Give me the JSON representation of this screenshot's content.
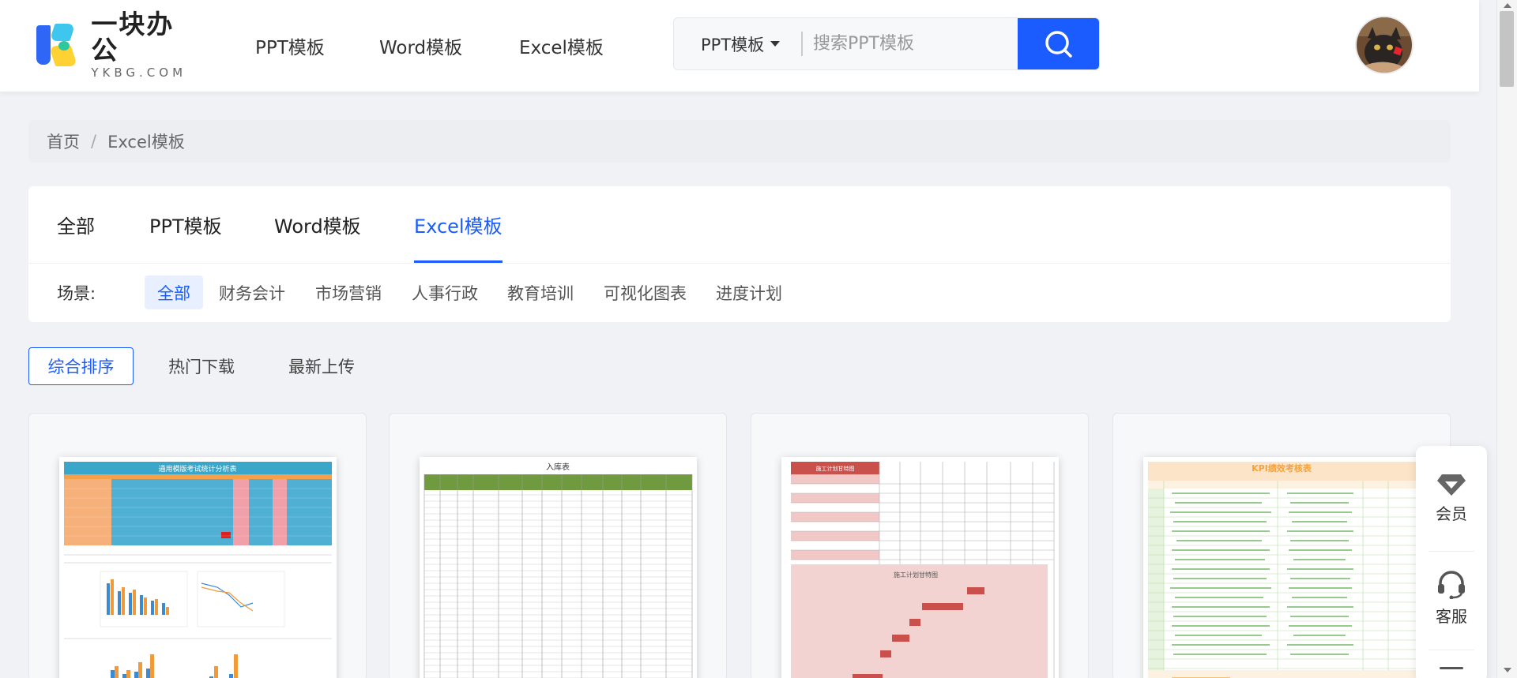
{
  "header": {
    "logo": {
      "name": "一块办公",
      "domain": "YKBG.COM"
    },
    "nav": [
      {
        "label": "PPT模板"
      },
      {
        "label": "Word模板"
      },
      {
        "label": "Excel模板"
      }
    ],
    "search": {
      "type_label": "PPT模板",
      "placeholder": "搜索PPT模板",
      "value": ""
    }
  },
  "breadcrumb": {
    "home": "首页",
    "separator": "/",
    "current": "Excel模板"
  },
  "category_tabs": [
    {
      "label": "全部",
      "active": false
    },
    {
      "label": "PPT模板",
      "active": false
    },
    {
      "label": "Word模板",
      "active": false
    },
    {
      "label": "Excel模板",
      "active": true
    }
  ],
  "scenes": {
    "label": "场景:",
    "items": [
      {
        "label": "全部",
        "active": true
      },
      {
        "label": "财务会计"
      },
      {
        "label": "市场营销"
      },
      {
        "label": "人事行政"
      },
      {
        "label": "教育培训"
      },
      {
        "label": "可视化图表"
      },
      {
        "label": "进度计划"
      }
    ]
  },
  "sort": [
    {
      "label": "综合排序",
      "active": true
    },
    {
      "label": "热门下载"
    },
    {
      "label": "最新上传"
    }
  ],
  "cards": [
    {
      "thumb_title": "通用模版考试统计分析表"
    },
    {
      "thumb_title": "入库表"
    },
    {
      "thumb_title": "施工计划甘特图",
      "thumb_header": "施工计划甘特图"
    },
    {
      "thumb_title": "KPI绩效考核表"
    }
  ],
  "float_bar": [
    {
      "label": "会员",
      "icon": "diamond-icon"
    },
    {
      "label": "客服",
      "icon": "headset-icon"
    }
  ],
  "colors": {
    "accent": "#1a5cff",
    "excel_green": "#6f9a3f",
    "gantt_red": "#c9504b",
    "kpi_orange": "#f7a23a",
    "kpi_green": "#5aa94a"
  }
}
